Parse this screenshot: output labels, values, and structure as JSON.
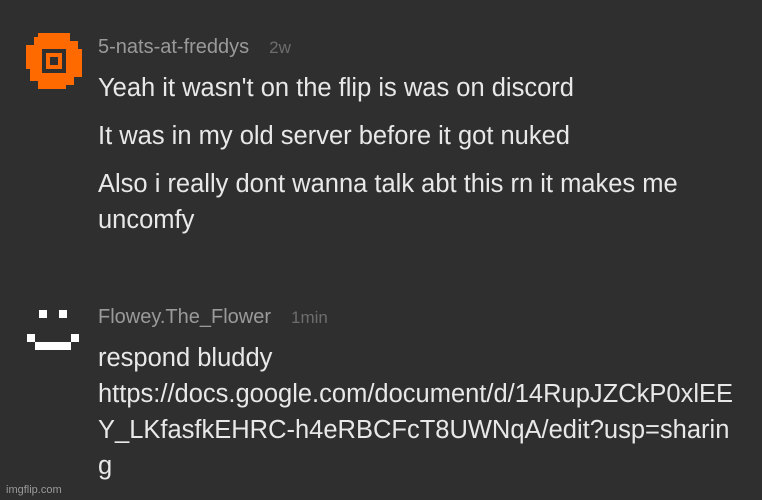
{
  "comments": [
    {
      "avatar_icon": "orange-pixel-square-icon",
      "avatar_color": "#ff6a00",
      "username": "5-nats-at-freddys",
      "timestamp": "2w",
      "paragraphs": [
        "Yeah it wasn't on the flip is was on discord",
        "It was in my old server before it got nuked",
        "Also i really dont wanna talk abt this rn it makes me uncomfy"
      ]
    },
    {
      "avatar_icon": "pixel-face-icon",
      "avatar_color": "#ffffff",
      "username": "Flowey.The_Flower",
      "timestamp": "1min",
      "text": "respond bluddy",
      "link": "https://docs.google.com/document/d/14RupJZCkP0xlEEY_LKfasfkEHRC-h4eRBCFcT8UWNqA/edit?usp=sharing"
    }
  ],
  "watermark": "imgflip.com"
}
